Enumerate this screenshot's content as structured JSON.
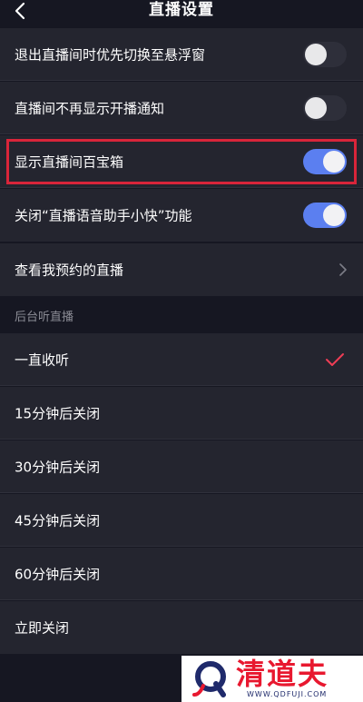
{
  "header": {
    "title": "直播设置"
  },
  "settings": [
    {
      "label": "退出直播间时优先切换至悬浮窗",
      "state": "off"
    },
    {
      "label": "直播间不再显示开播通知",
      "state": "off"
    },
    {
      "label": "显示直播间百宝箱",
      "state": "on"
    },
    {
      "label": "关闭“直播语音助手小快”功能",
      "state": "on"
    }
  ],
  "link_row": {
    "label": "查看我预约的直播"
  },
  "background_listen": {
    "section_title": "后台听直播",
    "options": [
      {
        "label": "一直收听",
        "selected": true
      },
      {
        "label": "15分钟后关闭",
        "selected": false
      },
      {
        "label": "30分钟后关闭",
        "selected": false
      },
      {
        "label": "45分钟后关闭",
        "selected": false
      },
      {
        "label": "60分钟后关闭",
        "selected": false
      },
      {
        "label": "立即关闭",
        "selected": false
      }
    ]
  },
  "watermark": {
    "brand": "清道夫",
    "domain": "WWW.QDFUJI.COM"
  },
  "colors": {
    "background": "#161722",
    "row": "#24252f",
    "toggle_on": "#5b7ff0",
    "toggle_off": "#2e2f3a",
    "check": "#ee3d55",
    "highlight": "#d9253a",
    "watermark_red": "#e8182f"
  },
  "icons": {
    "back": "chevron-left-icon",
    "link": "chevron-right-icon",
    "selected": "checkmark-icon"
  }
}
